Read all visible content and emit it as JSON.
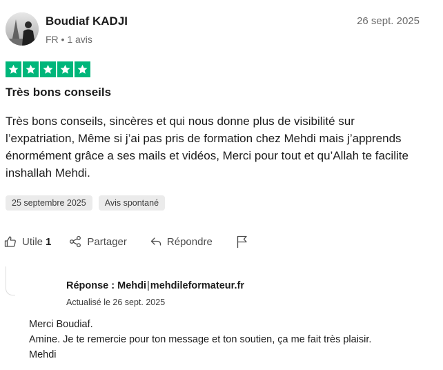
{
  "review": {
    "author_name": "Boudiaf KADJI",
    "author_meta": "FR • 1 avis",
    "date": "26 sept. 2025",
    "rating": 5,
    "star_color": "#00b67a",
    "title": "Très bons conseils",
    "body": "Très bons conseils, sincères et qui nous donne plus de visibilité sur l’expatriation, Même si j’ai pas pris de formation chez Mehdi mais j’apprends énormément grâce a ses mails et vidéos, Merci pour tout et qu’Allah te facilite inshallah Mehdi.",
    "tags": [
      "25 septembre 2025",
      "Avis spontané"
    ]
  },
  "actions": {
    "useful_label": "Utile",
    "useful_count": "1",
    "share_label": "Partager",
    "reply_label": "Répondre"
  },
  "reply": {
    "title": "Réponse : Mehdi",
    "separator": "|",
    "company": "mehdileformateur.fr",
    "updated": "Actualisé le 26 sept. 2025",
    "lines": [
      "Merci Boudiaf.",
      "Amine. Je te remercie pour ton message et ton soutien, ça me fait très plaisir.",
      "Mehdi"
    ]
  },
  "icons": {
    "star": "star-icon",
    "useful": "thumbs-up-icon",
    "share": "share-icon",
    "reply": "reply-arrow-icon",
    "report": "flag-icon"
  }
}
